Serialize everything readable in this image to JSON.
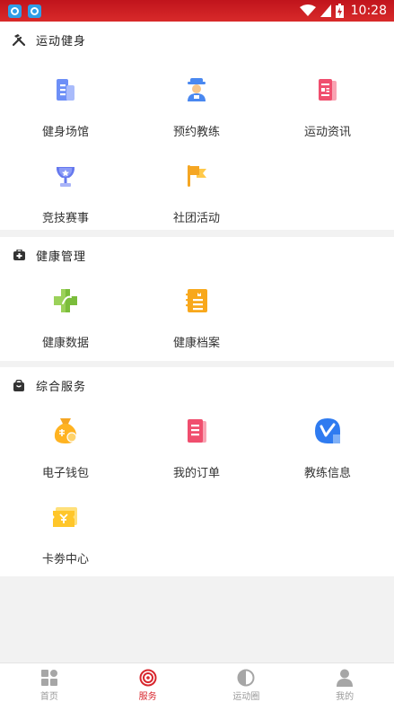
{
  "status_bar": {
    "time": "10:28"
  },
  "sections": [
    {
      "title": "运动健身",
      "items": [
        {
          "label": "健身场馆",
          "icon": "gym-building-icon"
        },
        {
          "label": "预约教练",
          "icon": "coach-icon"
        },
        {
          "label": "运动资讯",
          "icon": "news-icon"
        },
        {
          "label": "竞技赛事",
          "icon": "trophy-icon"
        },
        {
          "label": "社团活动",
          "icon": "flag-icon"
        }
      ]
    },
    {
      "title": "健康管理",
      "items": [
        {
          "label": "健康数据",
          "icon": "health-cross-icon"
        },
        {
          "label": "健康档案",
          "icon": "health-record-icon"
        }
      ]
    },
    {
      "title": "综合服务",
      "items": [
        {
          "label": "电子钱包",
          "icon": "wallet-bag-icon"
        },
        {
          "label": "我的订单",
          "icon": "order-list-icon"
        },
        {
          "label": "教练信息",
          "icon": "coach-info-icon"
        },
        {
          "label": "卡劵中心",
          "icon": "coupon-icon"
        }
      ]
    }
  ],
  "tabs": [
    {
      "label": "首页",
      "icon": "home-grid-icon"
    },
    {
      "label": "服务",
      "icon": "target-icon"
    },
    {
      "label": "运动圈",
      "icon": "half-circle-icon"
    },
    {
      "label": "我的",
      "icon": "person-icon"
    }
  ],
  "active_tab": "服务",
  "colors": {
    "accent": "#d8262d",
    "status_bar": "#c81e24"
  }
}
